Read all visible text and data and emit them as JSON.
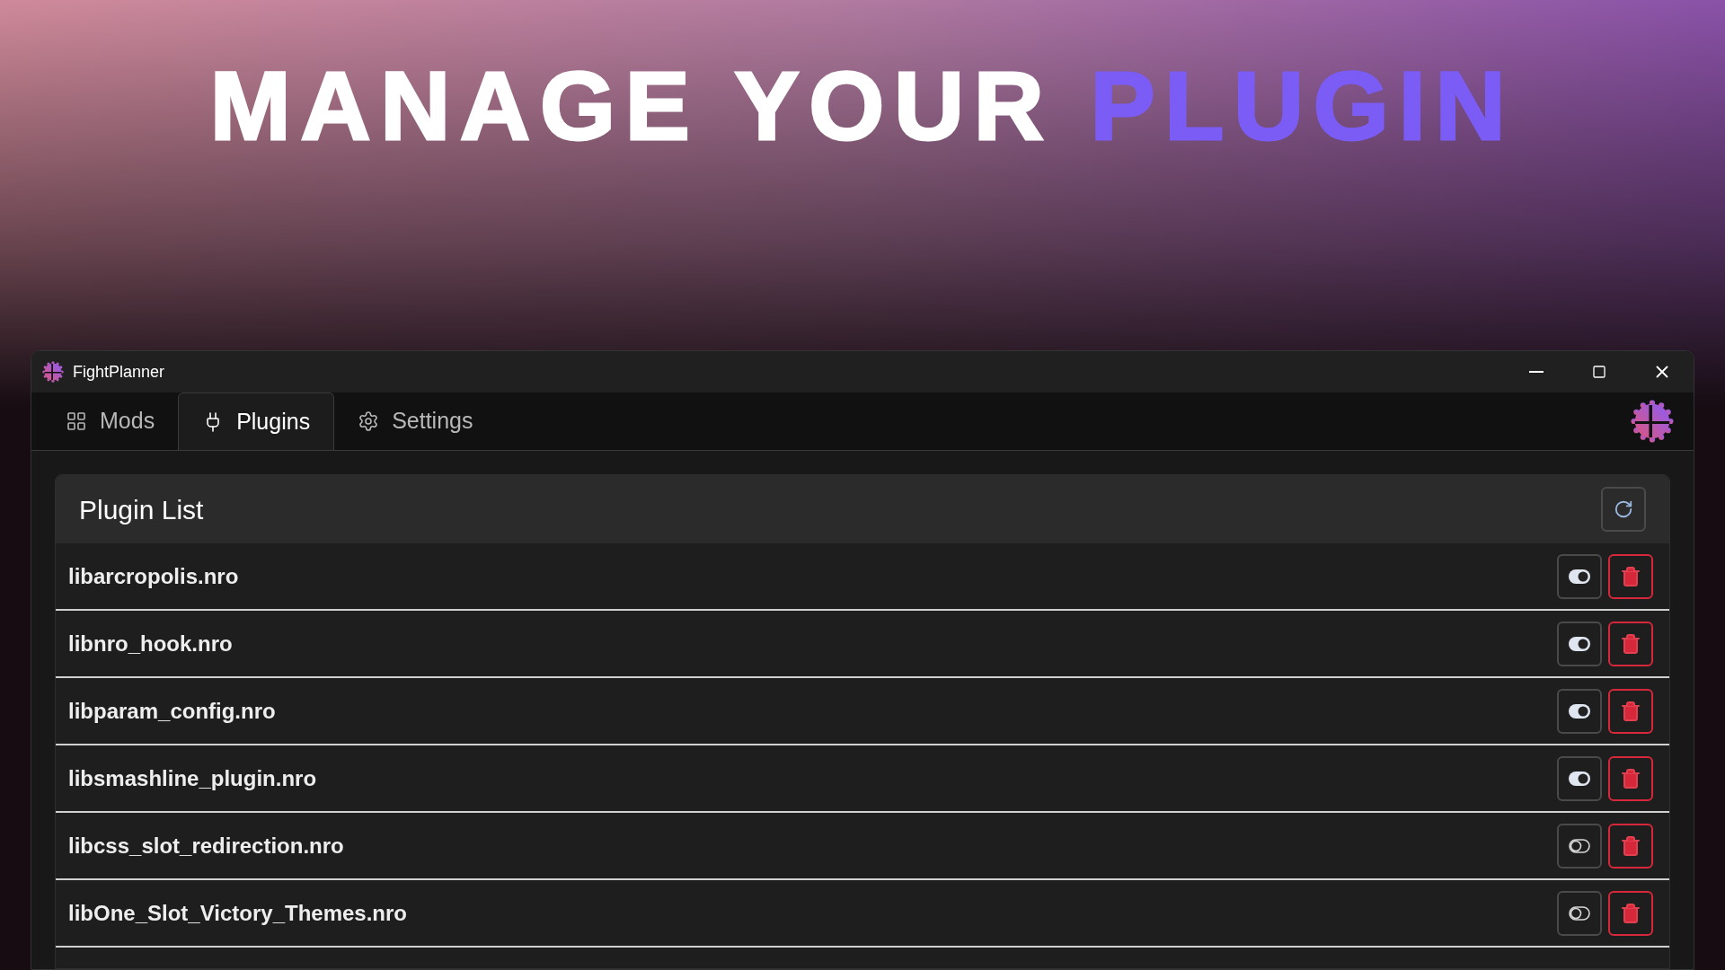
{
  "headline": {
    "text": "MANAGE YOUR",
    "accent": "PLUGIN"
  },
  "window": {
    "title": "FightPlanner"
  },
  "tabs": [
    {
      "label": "Mods",
      "kind": "grid",
      "selected": false
    },
    {
      "label": "Plugins",
      "kind": "plug",
      "selected": true
    },
    {
      "label": "Settings",
      "kind": "gear",
      "selected": false
    }
  ],
  "panel": {
    "title": "Plugin List"
  },
  "plugins": [
    {
      "name": "libarcropolis.nro",
      "enabled": true
    },
    {
      "name": "libnro_hook.nro",
      "enabled": true
    },
    {
      "name": "libparam_config.nro",
      "enabled": true
    },
    {
      "name": "libsmashline_plugin.nro",
      "enabled": true
    },
    {
      "name": "libcss_slot_redirection.nro",
      "enabled": false
    },
    {
      "name": "libOne_Slot_Victory_Themes.nro",
      "enabled": false
    }
  ]
}
